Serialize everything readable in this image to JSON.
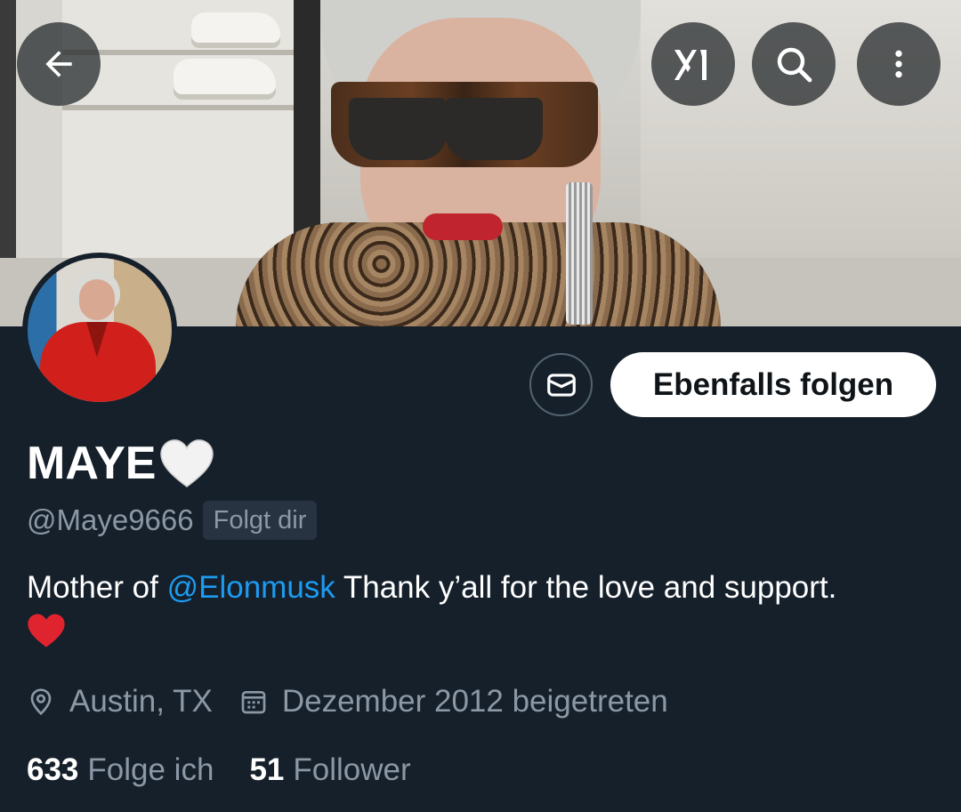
{
  "profile": {
    "name": "MAYE",
    "handle": "@Maye9666",
    "follows_you_badge": "Folgt dir",
    "bio": {
      "prefix": "Mother of ",
      "mention": "@Elonmusk",
      "suffix": " Thank y’all for the love and support."
    },
    "location": "Austin, TX",
    "joined": "Dezember 2012 beigetreten"
  },
  "actions": {
    "follow_back_label": "Ebenfalls folgen"
  },
  "stats": {
    "following_count": "633",
    "following_label": "Folge ich",
    "followers_count": "51",
    "followers_label": "Follower"
  },
  "icons": {
    "back": "arrow-left-icon",
    "grok": "grok-icon",
    "search": "search-icon",
    "more": "more-vertical-icon",
    "message": "envelope-icon",
    "location": "location-pin-icon",
    "calendar": "calendar-icon",
    "name_emoji": "white-heart-icon",
    "bio_emoji": "red-heart-icon"
  },
  "colors": {
    "background": "#15202b",
    "accent_link": "#1d9bf0",
    "secondary_text": "#8b98a5",
    "follow_button_bg": "#ffffff",
    "heart_red": "#e0242f"
  }
}
